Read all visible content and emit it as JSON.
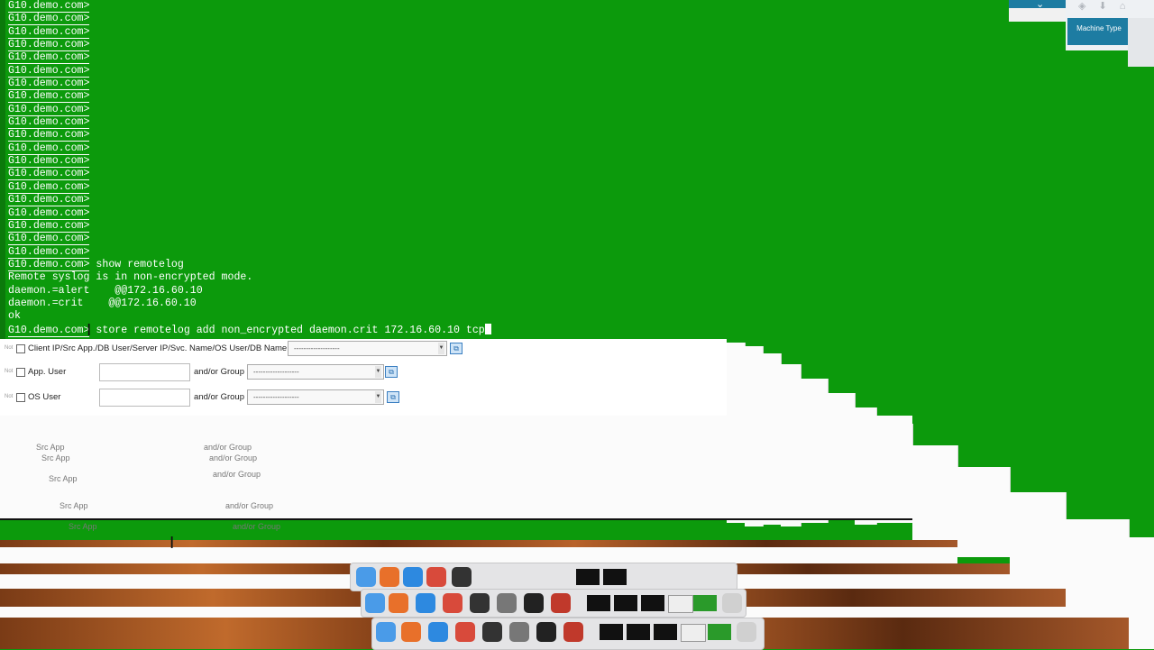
{
  "terminal": {
    "prompt": "G10.demo.com>",
    "empty_prompt_count": 20,
    "output": [
      {
        "prompt": "G10.demo.com>",
        "cmd": " show remotelog"
      },
      {
        "text": "Remote syslog is in non-encrypted mode."
      },
      {
        "text": "daemon.=alert    @@172.16.60.10"
      },
      {
        "text": "daemon.=crit    @@172.16.60.10"
      },
      {
        "text": "ok"
      },
      {
        "prompt": "G10.demo.com>",
        "cmd": " store remotelog add non_encrypted daemon.crit 172.16.60.10 tcp"
      }
    ],
    "background_color": "#0c9a0c"
  },
  "top_right": {
    "machine_type_label": "Machine Type",
    "chevron": "chevron-down-icon",
    "accent_color": "#1d7ca2"
  },
  "filter_form": {
    "not_label": "Not",
    "rows": [
      {
        "label": "Client IP/Src App./DB User/Server IP/Svc. Name/OS User/DB Name",
        "select_value": "-------------------"
      },
      {
        "label": "App. User",
        "group_label": "and/or Group",
        "select_value": "-------------------"
      },
      {
        "label": "OS User",
        "group_label": "and/or Group",
        "select_value": "-------------------"
      }
    ]
  },
  "ghost": {
    "src_app_label": "Src App",
    "group_label": "and/or Group"
  },
  "dock": {
    "apps": [
      "finder-icon",
      "firefox-icon",
      "safari-icon",
      "chrome-icon",
      "activity-monitor-icon",
      "system-preferences-icon",
      "terminal-icon",
      "parallels-icon",
      "trash-icon"
    ]
  }
}
